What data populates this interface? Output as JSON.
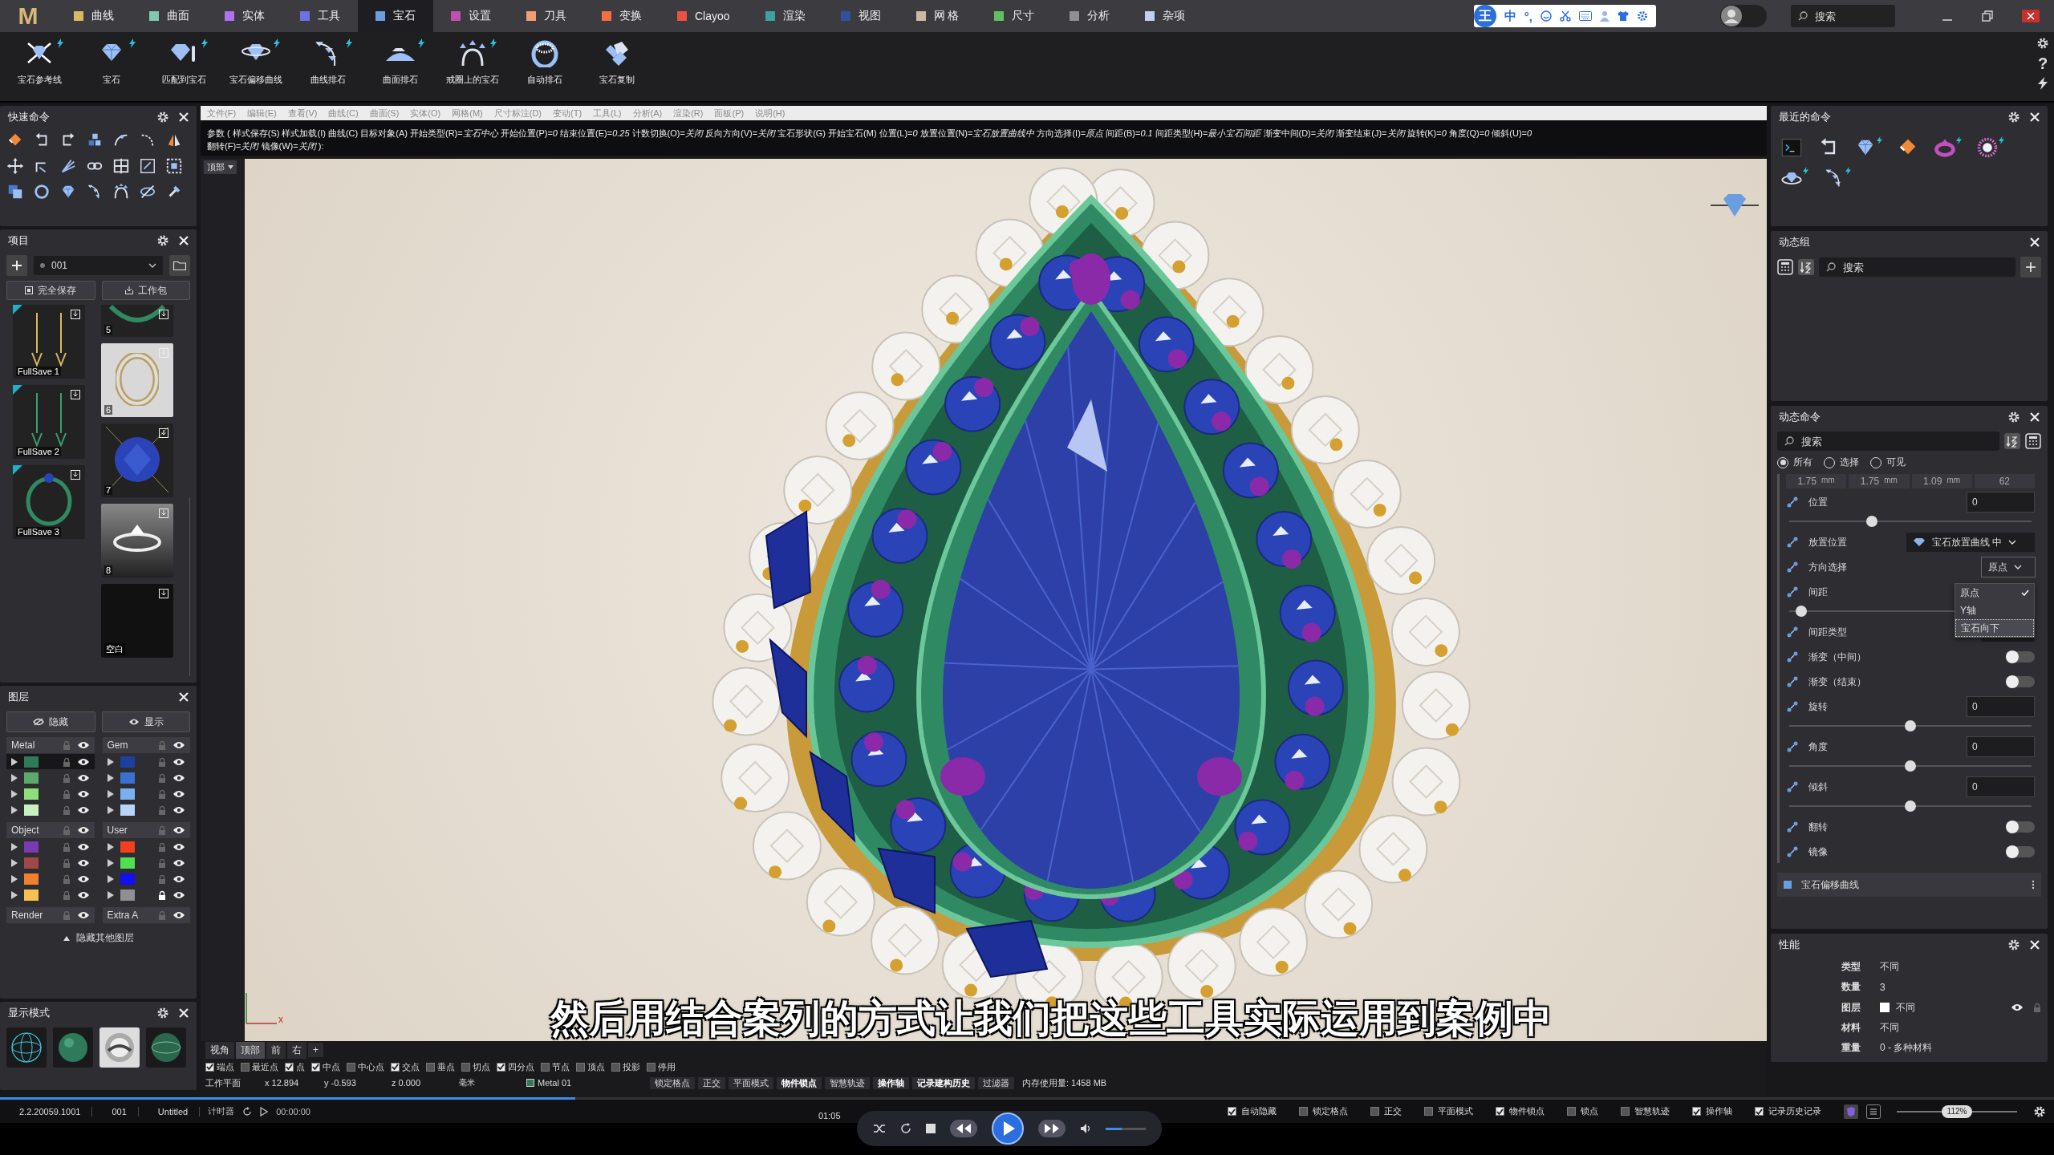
{
  "menu_bar": {
    "logo": "M",
    "tabs": [
      {
        "label": "曲线",
        "color": "#d8b860",
        "selected": false
      },
      {
        "label": "曲面",
        "color": "#80c8b0",
        "selected": false
      },
      {
        "label": "实体",
        "color": "#b070f0",
        "selected": false
      },
      {
        "label": "工具",
        "color": "#7070e0",
        "selected": false
      },
      {
        "label": "宝石",
        "color": "#6a9ee0",
        "selected": true
      },
      {
        "label": "设置",
        "color": "#c050b0",
        "selected": false
      },
      {
        "label": "刀具",
        "color": "#f0a070",
        "selected": false
      },
      {
        "label": "变换",
        "color": "#f07040",
        "selected": false
      },
      {
        "label": "Clayoo",
        "color": "#f05040",
        "selected": false
      },
      {
        "label": "渲染",
        "color": "#40a0a0",
        "selected": false
      },
      {
        "label": "视图",
        "color": "#3050a0",
        "selected": false
      },
      {
        "label": "网 格",
        "color": "#d0b8a0",
        "selected": false
      },
      {
        "label": "尺寸",
        "color": "#60c060",
        "selected": false
      },
      {
        "label": "分析",
        "color": "#909090",
        "selected": false
      },
      {
        "label": "杂项",
        "color": "#c0d0f0",
        "selected": false
      }
    ],
    "ime_toolbar": {
      "badge": "王",
      "items": [
        "中",
        "°,"
      ]
    },
    "account": {
      "on": false
    },
    "search": {
      "placeholder": "搜索"
    }
  },
  "ribbon": {
    "tools": [
      {
        "label": "宝石参考线",
        "flash": true
      },
      {
        "label": "宝石",
        "flash": true
      },
      {
        "label": "匹配到宝石",
        "flash": true
      },
      {
        "label": "宝石偏移曲线",
        "flash": true
      },
      {
        "label": "曲线排石",
        "flash": true
      },
      {
        "label": "曲面排石",
        "flash": true
      },
      {
        "label": "戒圈上的宝石",
        "flash": true
      },
      {
        "label": "自动排石",
        "flash": false
      },
      {
        "label": "宝石复制",
        "flash": false
      }
    ],
    "help_glyph": "?"
  },
  "quick_commands": {
    "title": "快速命令"
  },
  "project": {
    "title": "项目",
    "file": "001",
    "buttons": [
      "完全保存",
      "工作包"
    ],
    "saves": [
      {
        "label": "FullSave 1",
        "kind": "earrings-gold",
        "flagged": true
      },
      {
        "label": "FullSave 2",
        "kind": "earrings-green",
        "flagged": true
      },
      {
        "label": "FullSave 3",
        "kind": "ring-green",
        "flagged": true
      }
    ],
    "items": [
      {
        "label": "5",
        "kind": "band-green",
        "flagged": false
      },
      {
        "label": "6",
        "kind": "ring-photo",
        "flagged": false
      },
      {
        "label": "7",
        "kind": "gem-blue",
        "flagged": false
      },
      {
        "label": "8",
        "kind": "ring-silver",
        "flagged": false
      },
      {
        "label": "空白",
        "kind": "blank",
        "flagged": false
      }
    ]
  },
  "layers": {
    "title": "图层",
    "hide": "隐藏",
    "show": "显示",
    "groups": [
      {
        "name": "Metal",
        "layers": [
          {
            "color": "#2f7a5a",
            "locked": false,
            "selected": true
          },
          {
            "color": "#5aaa6a",
            "locked": false,
            "selected": false
          },
          {
            "color": "#8ee07a",
            "locked": false,
            "selected": false
          },
          {
            "color": "#c8f0c0",
            "locked": false,
            "selected": false
          }
        ]
      },
      {
        "name": "Gem",
        "layers": [
          {
            "color": "#1c3fa0",
            "locked": false,
            "selected": false
          },
          {
            "color": "#3a70d0",
            "locked": false,
            "selected": false
          },
          {
            "color": "#7ab0f0",
            "locked": false,
            "selected": false
          },
          {
            "color": "#b8d4f8",
            "locked": false,
            "selected": false
          }
        ]
      },
      {
        "name": "Object",
        "layers": [
          {
            "color": "#7a3ab0",
            "locked": false,
            "selected": false
          },
          {
            "color": "#a04848",
            "locked": false,
            "selected": false
          },
          {
            "color": "#f08030",
            "locked": false,
            "selected": false
          },
          {
            "color": "#f8c050",
            "locked": false,
            "selected": false
          }
        ]
      },
      {
        "name": "User",
        "layers": [
          {
            "color": "#f04020",
            "locked": false,
            "selected": false
          },
          {
            "color": "#50e050",
            "locked": false,
            "selected": false
          },
          {
            "color": "#1010f0",
            "locked": false,
            "selected": false
          },
          {
            "color": "#909090",
            "locked": true,
            "selected": false
          }
        ]
      },
      {
        "name": "Render"
      },
      {
        "name": "Extra A"
      }
    ],
    "footer": "隐藏其他图层"
  },
  "display_modes": {
    "title": "显示模式",
    "modes": [
      {
        "kind": "wireframe"
      },
      {
        "kind": "shaded"
      },
      {
        "kind": "chrome"
      },
      {
        "kind": "ghosted"
      }
    ]
  },
  "command_area": {
    "menu": [
      "文件(F)",
      "编辑(E)",
      "查看(V)",
      "曲线(C)",
      "曲面(S)",
      "实体(O)",
      "网格(M)",
      "尺寸标注(D)",
      "变动(T)",
      "工具(L)",
      "分析(A)",
      "渲染(R)",
      "面板(P)",
      "说明(H)"
    ],
    "prompt": [
      "参数 ( 样式保存(S) 样式加载(I) 曲线(C) 目标对象(A) 开始类型(R)=*宝石中心* 开始位置(P)=*0* 结束位置(E)=*0.25* 计数切换(O)=*关闭* 反向方向(V)=*关闭* 宝石形状(G) 开始宝石(M) 位置(L)=*0* 放置位置(N)=*宝石放置曲线中* 方向选择(I)=*原点* 间距(B)=*0.1* 间距类型(H)=*最小宝石间距* 渐变中间(D)=*关闭* 渐变结束(J)=*关闭* 旋转(K)=*0* 角度(Q)=*0* 倾斜(U)=*0*",
      "翻转(F)=*关闭* 镜像(W)=*关闭* ):"
    ]
  },
  "viewport": {
    "tab": "顶部",
    "axis_label": "x",
    "view_tabs": [
      {
        "label": "视角",
        "selected": false
      },
      {
        "label": "顶部",
        "selected": true
      },
      {
        "label": "前",
        "selected": false
      },
      {
        "label": "右",
        "selected": false
      },
      {
        "label": "+",
        "selected": false
      }
    ],
    "osnaps": [
      {
        "label": "端点",
        "checked": true
      },
      {
        "label": "最近点",
        "checked": false
      },
      {
        "label": "点",
        "checked": true
      },
      {
        "label": "中点",
        "checked": true
      },
      {
        "label": "中心点",
        "checked": false
      },
      {
        "label": "交点",
        "checked": true
      },
      {
        "label": "垂点",
        "checked": false
      },
      {
        "label": "切点",
        "checked": false
      },
      {
        "label": "四分点",
        "checked": true
      },
      {
        "label": "节点",
        "checked": false
      },
      {
        "label": "顶点",
        "checked": false
      },
      {
        "label": "投影",
        "checked": false
      },
      {
        "label": "停用",
        "checked": false
      }
    ],
    "status": {
      "plane": "工作平面",
      "x": "x 12.894",
      "y": "y -0.593",
      "z": "z 0.000",
      "unit": "毫米",
      "layer": "Metal 01",
      "modes": [
        {
          "label": "锁定格点",
          "on": false
        },
        {
          "label": "正交",
          "on": false
        },
        {
          "label": "平面模式",
          "on": false
        },
        {
          "label": "物件锁点",
          "on": true
        },
        {
          "label": "智慧轨迹",
          "on": false
        },
        {
          "label": "操作轴",
          "on": true
        },
        {
          "label": "记录建构历史",
          "on": true
        },
        {
          "label": "过滤器",
          "on": false
        }
      ],
      "memory": "内存使用量: 1458 MB"
    }
  },
  "subtitle": "然后用结合案列的方式让我们把这些工具实际运用到案例中",
  "recent_commands": {
    "title": "最近的命令"
  },
  "dynamic_group": {
    "title": "动态组",
    "search": {
      "placeholder": "搜索"
    }
  },
  "dynamic_command": {
    "title": "动态命令",
    "search": {
      "placeholder": "搜索"
    },
    "filters": [
      {
        "label": "所有",
        "selected": true
      },
      {
        "label": "选择",
        "selected": false
      },
      {
        "label": "可见",
        "selected": false
      }
    ],
    "dims": [
      {
        "value": "1.75",
        "unit": "mm"
      },
      {
        "value": "1.75",
        "unit": "mm"
      },
      {
        "value": "1.09",
        "unit": "mm"
      },
      {
        "value": "62"
      }
    ],
    "rows": [
      {
        "kind": "number",
        "label": "位置",
        "value": "0",
        "level": 0.34
      },
      {
        "kind": "select",
        "label": "放置位置",
        "value": "宝石放置曲线 中"
      },
      {
        "kind": "select",
        "label": "方向选择",
        "value": "原点",
        "open": true
      },
      {
        "kind": "slider",
        "label": "间距",
        "level": 0.05
      },
      {
        "kind": "select",
        "label": "间距类型"
      },
      {
        "kind": "toggle",
        "label": "渐变（中间）",
        "on": false
      },
      {
        "kind": "toggle",
        "label": "渐变（结束）",
        "on": false
      },
      {
        "kind": "number",
        "label": "旋转",
        "value": "0",
        "level": 0.5
      },
      {
        "kind": "number",
        "label": "角度",
        "value": "0",
        "level": 0.5
      },
      {
        "kind": "number",
        "label": "倾斜",
        "value": "0",
        "level": 0.5
      },
      {
        "kind": "toggle",
        "label": "翻转",
        "on": false
      },
      {
        "kind": "toggle",
        "label": "镜像",
        "on": false
      }
    ],
    "dropdown": [
      {
        "label": "原点",
        "checked": true,
        "highlighted": false
      },
      {
        "label": "Y轴",
        "checked": false,
        "highlighted": false
      },
      {
        "label": "宝石向下",
        "checked": false,
        "highlighted": true
      }
    ],
    "section": "宝石偏移曲线"
  },
  "properties": {
    "title": "性能",
    "rows": [
      {
        "label": "类型",
        "value": "不同"
      },
      {
        "label": "数量",
        "value": "3"
      },
      {
        "label": "图层",
        "value": "不同",
        "kind": "layer"
      },
      {
        "label": "材料",
        "value": "不同"
      },
      {
        "label": "重量",
        "value": "0 - 多种材料"
      }
    ]
  },
  "status_bar": {
    "version": "2.2.20059.1001",
    "file": "001",
    "name": "Untitled",
    "timer": "计时器",
    "time": "00:00:00",
    "toggles": [
      {
        "label": "自动隐藏",
        "checked": true
      },
      {
        "label": "锁定格点",
        "checked": false
      },
      {
        "label": "正交",
        "checked": false
      },
      {
        "label": "平面模式",
        "checked": false
      },
      {
        "label": "物件锁点",
        "checked": true
      },
      {
        "label": "锁点",
        "checked": false
      },
      {
        "label": "智慧轨迹",
        "checked": false
      },
      {
        "label": "操作轴",
        "checked": true
      },
      {
        "label": "记录历史记录",
        "checked": true
      }
    ],
    "zoom": {
      "label": "112%",
      "level": 0.5
    }
  },
  "player": {
    "time": "01:05",
    "progress": {
      "level": 0.28
    },
    "volume": {
      "level": 0.4
    }
  }
}
